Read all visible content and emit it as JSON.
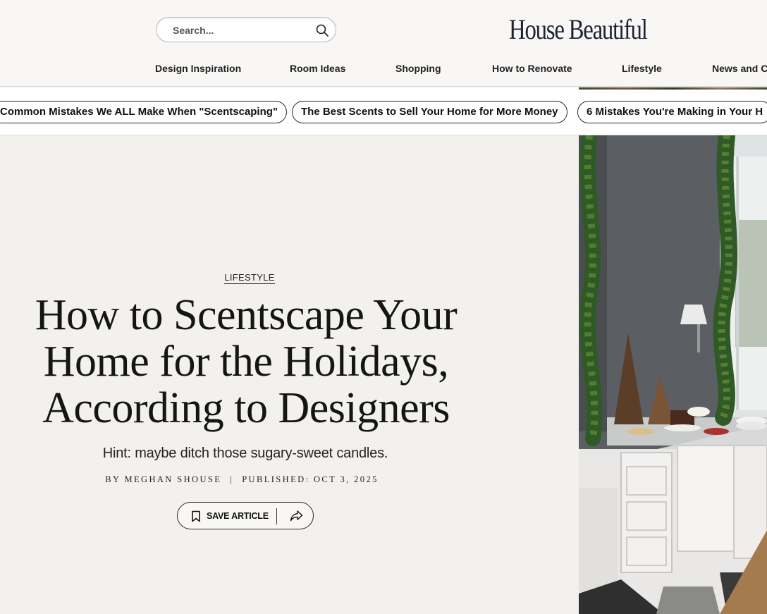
{
  "header": {
    "search_placeholder": "Search...",
    "logo_text": "House Beautiful"
  },
  "nav": {
    "items": [
      {
        "label": "Design Inspiration"
      },
      {
        "label": "Room Ideas"
      },
      {
        "label": "Shopping"
      },
      {
        "label": "How to Renovate"
      },
      {
        "label": "Lifestyle"
      },
      {
        "label": "News and Ce"
      }
    ]
  },
  "related": {
    "pills": [
      {
        "label": "Common Mistakes We ALL Make When \"Scentscaping\""
      },
      {
        "label": "The Best Scents to Sell Your Home for More Money"
      },
      {
        "label": "6 Mistakes You're Making in Your H"
      }
    ]
  },
  "article": {
    "category": "LIFESTYLE",
    "title_lines": [
      "How to Scentscape Your",
      "Home for the Holidays,",
      "According to Designers"
    ],
    "dek": "Hint: maybe ditch those sugary-sweet candles.",
    "byline": "By Meghan Shouse",
    "published": "Published: Oct 3, 2025",
    "byline_separator": "|",
    "save_label": "SAVE ARTICLE"
  },
  "colors": {
    "background": "#f3f1ee",
    "header_bg": "#f8f7f6",
    "logo": "#1d2333",
    "text": "#151515"
  },
  "icons": {
    "search": "search-icon",
    "bookmark": "bookmark-icon",
    "share": "share-icon"
  }
}
